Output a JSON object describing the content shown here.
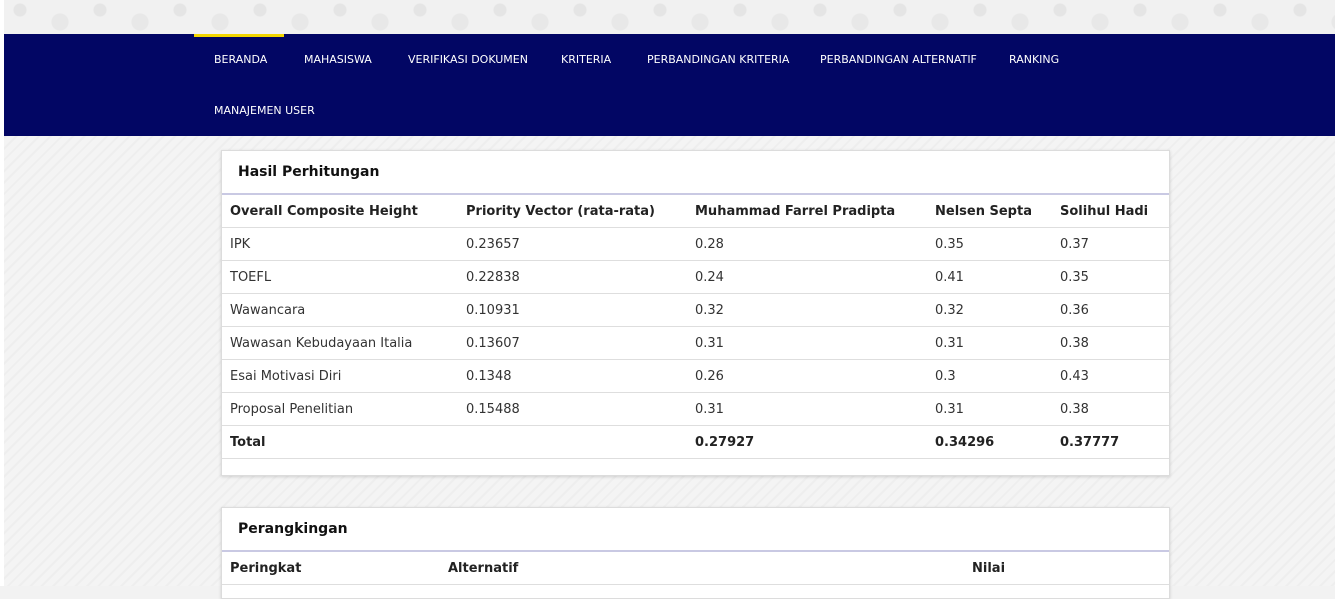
{
  "nav": {
    "items": [
      "BERANDA",
      "MAHASISWA",
      "VERIFIKASI DOKUMEN",
      "KRITERIA",
      "PERBANDINGAN KRITERIA",
      "PERBANDINGAN ALTERNATIF",
      "RANKING",
      "MANAJEMEN USER"
    ],
    "active": "BERANDA",
    "active_color": "#f2d600",
    "background": "#020664"
  },
  "hasil": {
    "title": "Hasil Perhitungan",
    "headers": [
      "Overall Composite Height",
      "Priority Vector (rata-rata)",
      "Muhammad Farrel Pradipta",
      "Nelsen Septa",
      "Solihul Hadi"
    ],
    "rows": [
      [
        "IPK",
        "0.23657",
        "0.28",
        "0.35",
        "0.37"
      ],
      [
        "TOEFL",
        "0.22838",
        "0.24",
        "0.41",
        "0.35"
      ],
      [
        "Wawancara",
        "0.10931",
        "0.32",
        "0.32",
        "0.36"
      ],
      [
        "Wawasan Kebudayaan Italia",
        "0.13607",
        "0.31",
        "0.31",
        "0.38"
      ],
      [
        "Esai Motivasi Diri",
        "0.1348",
        "0.26",
        "0.3",
        "0.43"
      ],
      [
        "Proposal Penelitian",
        "0.15488",
        "0.31",
        "0.31",
        "0.38"
      ]
    ],
    "total": [
      "Total",
      "",
      "0.27927",
      "0.34296",
      "0.37777"
    ]
  },
  "ranking": {
    "title": "Perangkingan",
    "headers": [
      "Peringkat",
      "Alternatif",
      "Nilai"
    ]
  }
}
